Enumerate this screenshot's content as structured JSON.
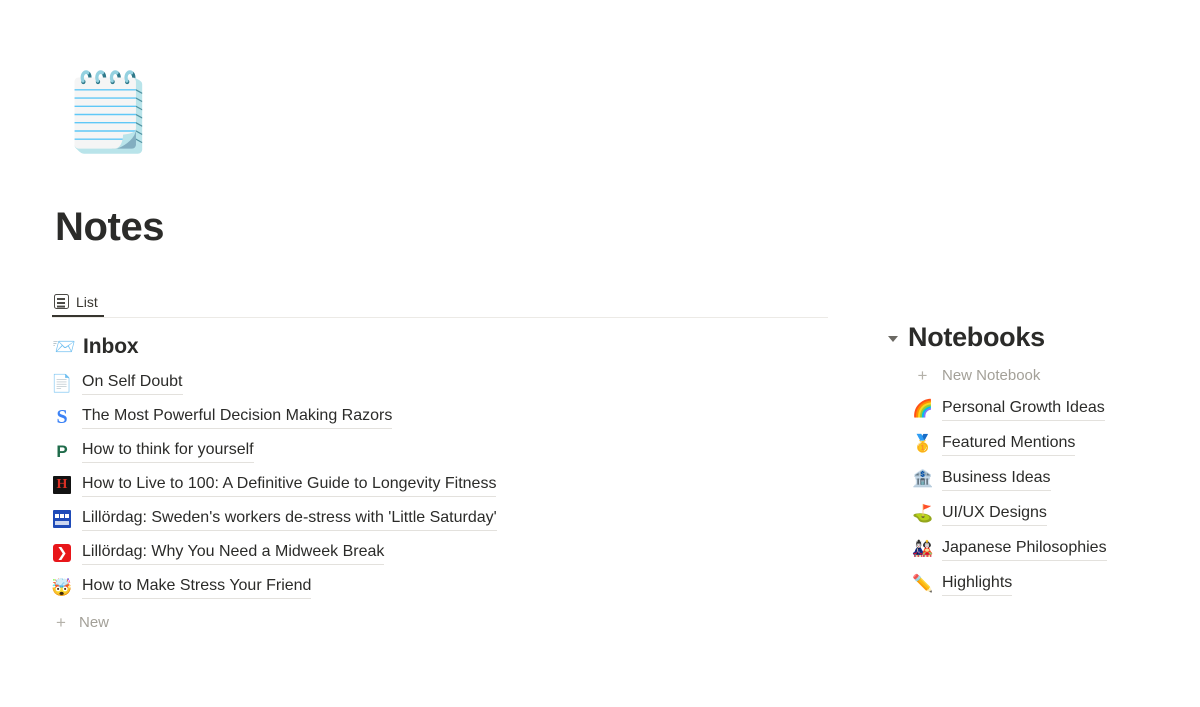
{
  "page": {
    "emoji": "🗒️",
    "emoji_name": "spiral-notepad",
    "title": "Notes"
  },
  "tabs": [
    {
      "label": "List",
      "icon": "list-icon",
      "active": true
    }
  ],
  "notes_section": {
    "header": {
      "emoji": "📨",
      "emoji_name": "incoming-envelope",
      "label": "Inbox"
    },
    "items": [
      {
        "title": "On Self Doubt",
        "icon": "document-icon",
        "icon_kind": "emoji",
        "icon_text": "📄"
      },
      {
        "title": "The Most Powerful Decision Making Razors",
        "icon": "substack-s-favicon",
        "icon_kind": "letter-s",
        "icon_text": "S"
      },
      {
        "title": "How to think for yourself",
        "icon": "perell-p-favicon",
        "icon_kind": "letter-p",
        "icon_text": "P"
      },
      {
        "title": "How to Live to 100: A Definitive Guide to Longevity Fitness",
        "icon": "harvard-h-favicon",
        "icon_kind": "letter-h",
        "icon_text": "H"
      },
      {
        "title": "Lillördag: Sweden's workers de-stress with 'Little Saturday'",
        "icon": "bbc-worklife-favicon",
        "icon_kind": "bbc",
        "icon_text": ""
      },
      {
        "title": "Lillördag: Why You Need a Midweek Break",
        "icon": "red-chevron-favicon",
        "icon_kind": "chevron",
        "icon_text": "❯"
      },
      {
        "title": "How to Make Stress Your Friend",
        "icon": "exploding-head-icon",
        "icon_kind": "emoji",
        "icon_text": "🤯"
      }
    ],
    "add_label": "New",
    "add_symbol": "+"
  },
  "notebooks_section": {
    "title": "Notebooks",
    "expanded": true,
    "add_label": "New Notebook",
    "add_symbol": "+",
    "items": [
      {
        "emoji": "🌈",
        "emoji_name": "rainbow",
        "label": "Personal Growth Ideas"
      },
      {
        "emoji": "🥇",
        "emoji_name": "first-place-medal",
        "label": "Featured Mentions"
      },
      {
        "emoji": "🏦",
        "emoji_name": "bank",
        "label": "Business Ideas"
      },
      {
        "emoji": "⛳",
        "emoji_name": "golf-flag",
        "label": "UI/UX Designs"
      },
      {
        "emoji": "🎎",
        "emoji_name": "japanese-dolls",
        "label": "Japanese Philosophies"
      },
      {
        "emoji": "✏️",
        "emoji_name": "pencil",
        "label": "Highlights"
      }
    ]
  },
  "colors": {
    "text": "#2b2b29",
    "muted": "#a3a098",
    "underline": "#e3e1dd",
    "tab_active": "#37352f",
    "divider": "#eceae6",
    "substack_blue": "#3b82f6",
    "perell_green": "#1f6b4a",
    "harvard_red": "#d93025",
    "bbc_blue": "#1f4bb8",
    "chevron_red": "#e8161a"
  }
}
